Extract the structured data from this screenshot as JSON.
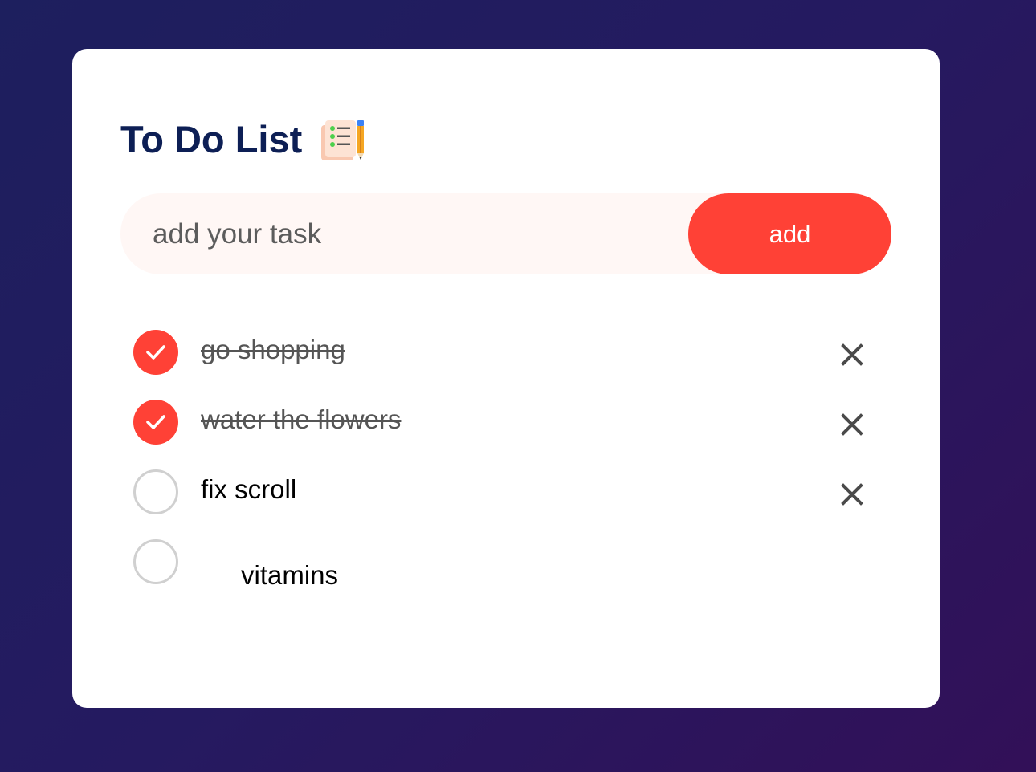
{
  "app": {
    "title": "To Do List",
    "title_icon": "notepad-pencil-icon"
  },
  "input": {
    "placeholder": "add your task",
    "value": ""
  },
  "add_button": {
    "label": "add"
  },
  "colors": {
    "accent": "#ff4136",
    "title": "#0d1f55",
    "background_start": "#1d1f5e",
    "background_end": "#321058"
  },
  "tasks": [
    {
      "text": "go shopping",
      "done": true,
      "removable": true
    },
    {
      "text": "water the flowers",
      "done": true,
      "removable": true
    },
    {
      "text": "fix scroll",
      "done": false,
      "removable": true
    },
    {
      "text": "vitamins",
      "done": false,
      "removable": false
    }
  ]
}
